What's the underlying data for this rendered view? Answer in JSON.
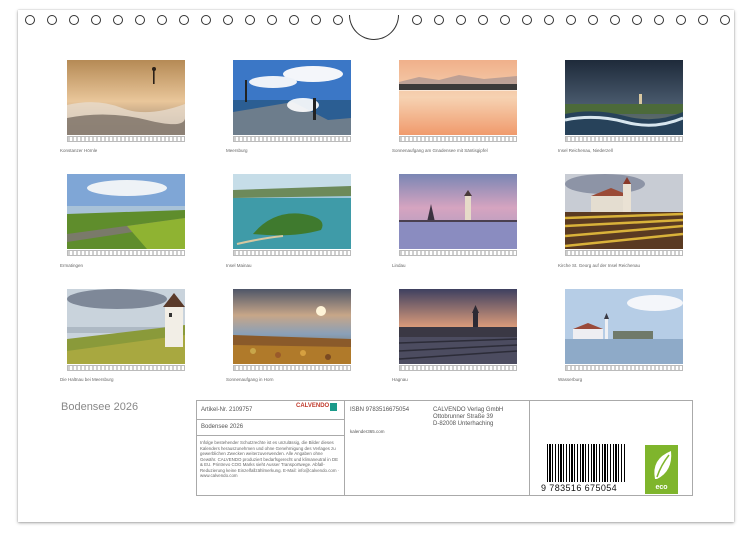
{
  "thumbnails": [
    {
      "caption": "Konstanzer Hörnle"
    },
    {
      "caption": "Meersburg"
    },
    {
      "caption": "Sonnenaufgang am Gnadensee mit Säntisgipfel"
    },
    {
      "caption": "Insel Reichenau, Niederzell"
    },
    {
      "caption": "Ermatingen"
    },
    {
      "caption": "Insel Mainau"
    },
    {
      "caption": "Lindau"
    },
    {
      "caption": "Kirche St. Georg auf der Insel Reichenau"
    },
    {
      "caption": "Die Haltnau bei Meersburg"
    },
    {
      "caption": "Sonnenaufgang in Horn"
    },
    {
      "caption": "Hagnau"
    },
    {
      "caption": "Wasserburg"
    }
  ],
  "title": "Bodensee 2026",
  "info": {
    "artikel": "Artikel-Nr. 2109757",
    "subtitle": "Bodensee 2026",
    "isbn": "ISBN 9783516675054",
    "publisher_lines": [
      "CALVENDO Verlag GmbH",
      "Ottobrunner Straße 39",
      "D-82008 Unterhaching"
    ],
    "website": "kalender365.com",
    "legal": "Infolge bestehender Schutzrechte ist es unzulässig, die Bilder dieses Kalenders herauszunehmen und ohne Genehmigung des Verlages zu gewerblichen Zwecken weiterzuverwenden. Alle Angaben ohne Gewähr. CALVENDO produziert bedarfsgerecht und klimaneutral in DE & EU. Printrevo COG Marks sieht Ausser Transportwege. Abfall-Reduzierung keine Einzelfallzählmerkung. E-Mail: info@calvendo.com · www.calvendo.com",
    "logo": "CALVENDO",
    "barcode_number": "9 783516 675054",
    "eco": "eco"
  }
}
